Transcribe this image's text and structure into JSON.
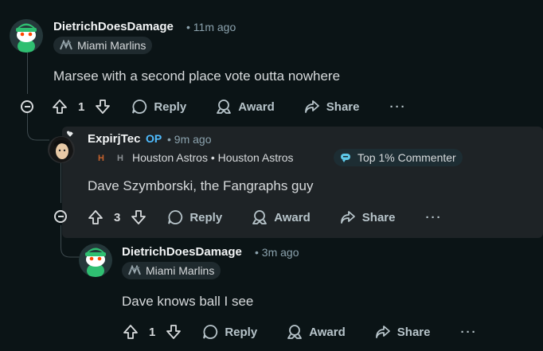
{
  "colors": {
    "background": "#0b1416",
    "highlight": "#1e2326",
    "op_blue": "#4fbcff",
    "top_badge_bg": "#233a44"
  },
  "comments": [
    {
      "username": "DietrichDoesDamage",
      "time": "• 11m ago",
      "flair": "Miami Marlins",
      "flair_icon": "marlins-logo-icon",
      "body": "Marsee with a second place vote outta nowhere",
      "score": "1",
      "reply_label": "Reply",
      "award_label": "Award",
      "share_label": "Share",
      "more_label": "···"
    },
    {
      "username": "ExpirjTec",
      "op_label": "OP",
      "time": "• 9m ago",
      "flair": "Houston Astros • Houston Astros",
      "flair_icon": "astros-logo-icon",
      "badge": "Top 1% Commenter",
      "badge_icon": "top-commenter-icon",
      "body": "Dave Szymborski, the Fangraphs guy",
      "score": "3",
      "reply_label": "Reply",
      "award_label": "Award",
      "share_label": "Share",
      "more_label": "···"
    },
    {
      "username": "DietrichDoesDamage",
      "time": "• 3m ago",
      "flair": "Miami Marlins",
      "flair_icon": "marlins-logo-icon",
      "body": "Dave knows ball I see",
      "score": "1",
      "reply_label": "Reply",
      "award_label": "Award",
      "share_label": "Share",
      "more_label": "···"
    }
  ]
}
